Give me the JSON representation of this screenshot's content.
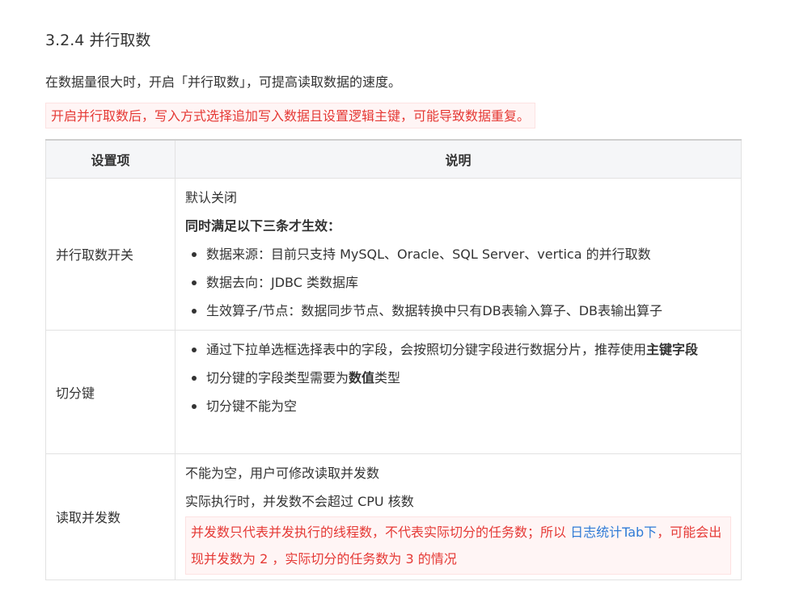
{
  "section": {
    "title": "3.2.4 并行取数",
    "intro": "在数据量很大时，开启「并行取数」，可提高读取数据的速度。",
    "warning": "开启并行取数后，写入方式选择追加写入数据且设置逻辑主键，可能导致数据重复。"
  },
  "table": {
    "headers": [
      "设置项",
      "说明"
    ],
    "rows": [
      {
        "name": "并行取数开关",
        "line1": "默认关闭",
        "bold_line": "同时满足以下三条才生效：",
        "bullets": [
          "数据来源：目前只支持 MySQL、Oracle、SQL Server、vertica 的并行取数",
          "数据去向：JDBC 类数据库",
          "生效算子/节点：数据同步节点、数据转换中只有DB表输入算子、DB表输出算子"
        ]
      },
      {
        "name": "切分键",
        "bullet1_prefix": "通过下拉单选框选择表中的字段，会按照切分键字段进行数据分片，推荐使用",
        "bullet1_bold": "主键字段",
        "bullet2_prefix": "切分键的字段类型需要为",
        "bullet2_bold": "数值",
        "bullet2_suffix": "类型",
        "bullet3": "切分键不能为空"
      },
      {
        "name": "读取并发数",
        "line1": "不能为空，用户可修改读取并发数",
        "line2": "实际执行时，并发数不会超过 CPU 核数",
        "warn_prefix": "并发数只代表并发执行的线程数，不代表实际切分的任务数；所以 ",
        "warn_link": "日志统计Tab下",
        "warn_suffix": "，可能会出现并发数为 2 ，实际切分的任务数为 3 的情况"
      }
    ]
  },
  "colors": {
    "warning_text": "#e53935",
    "warning_bg": "#fff5f5",
    "link": "#2f7bd6",
    "header_bg": "#f5f6f8"
  }
}
